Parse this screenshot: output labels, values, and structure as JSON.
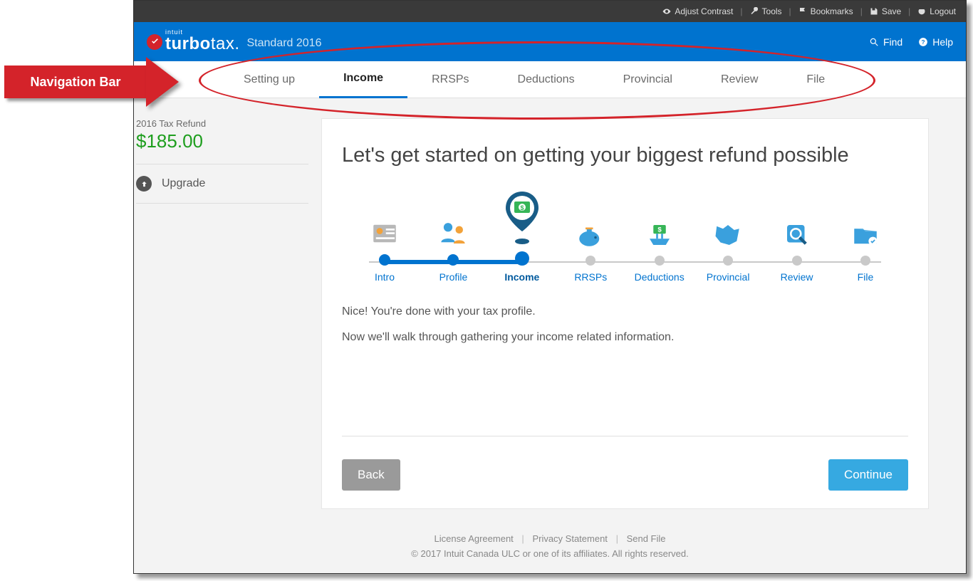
{
  "annotation": {
    "label": "Navigation Bar"
  },
  "topbar": {
    "contrast": "Adjust Contrast",
    "tools": "Tools",
    "bookmarks": "Bookmarks",
    "save": "Save",
    "logout": "Logout"
  },
  "brand": {
    "intuit": "intuit",
    "name_a": "turbo",
    "name_b": "tax",
    "edition": "Standard 2016",
    "find": "Find",
    "help": "Help"
  },
  "nav": [
    {
      "label": "Setting up",
      "active": false
    },
    {
      "label": "Income",
      "active": true
    },
    {
      "label": "RRSPs",
      "active": false
    },
    {
      "label": "Deductions",
      "active": false
    },
    {
      "label": "Provincial",
      "active": false
    },
    {
      "label": "Review",
      "active": false
    },
    {
      "label": "File",
      "active": false
    }
  ],
  "sidebar": {
    "refund_label": "2016 Tax Refund",
    "refund_amount": "$185.00",
    "upgrade": "Upgrade"
  },
  "main": {
    "heading": "Let's get started on getting your biggest refund possible",
    "text1": "Nice! You're done with your tax profile.",
    "text2": "Now we'll walk through gathering your income related information.",
    "back": "Back",
    "continue": "Continue"
  },
  "steps": [
    {
      "label": "Intro",
      "state": "done"
    },
    {
      "label": "Profile",
      "state": "done"
    },
    {
      "label": "Income",
      "state": "current"
    },
    {
      "label": "RRSPs",
      "state": "todo"
    },
    {
      "label": "Deductions",
      "state": "todo"
    },
    {
      "label": "Provincial",
      "state": "todo"
    },
    {
      "label": "Review",
      "state": "todo"
    },
    {
      "label": "File",
      "state": "todo"
    }
  ],
  "footer": {
    "license": "License Agreement",
    "privacy": "Privacy Statement",
    "sendfile": "Send File",
    "copy": "© 2017 Intuit Canada ULC or one of its affiliates. All rights reserved."
  }
}
